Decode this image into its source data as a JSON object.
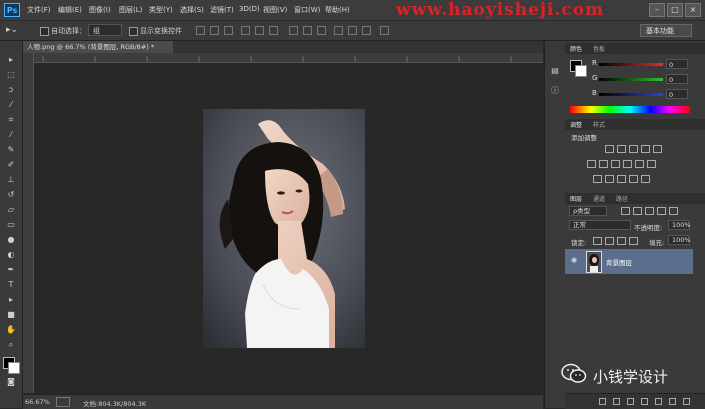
{
  "app": {
    "logo": "Ps",
    "watermark": "www.haoyisheji.com"
  },
  "menu": [
    "文件(F)",
    "编辑(E)",
    "图像(I)",
    "图层(L)",
    "类型(Y)",
    "选择(S)",
    "滤镜(T)",
    "3D(D)",
    "视图(V)",
    "窗口(W)",
    "帮助(H)"
  ],
  "window_controls": [
    "–",
    "□",
    "×"
  ],
  "options": {
    "auto_select_label": "自动选择：",
    "auto_select_value": "组",
    "show_transform_label": "显示变换控件",
    "workspace": "基本功能"
  },
  "document": {
    "tab_title": "人物.png @ 66.7% (背景图层, RGB/8#) *",
    "zoom": "66.67%",
    "doc_size": "文档:804.3K/804.3K"
  },
  "color_panel": {
    "tabs": [
      "颜色",
      "色板"
    ],
    "sliders": [
      {
        "label": "R",
        "value": "0",
        "color": "#d83030"
      },
      {
        "label": "G",
        "value": "0",
        "color": "#30c030"
      },
      {
        "label": "B",
        "value": "0",
        "color": "#3040e0"
      }
    ]
  },
  "adjust_panel": {
    "tabs": [
      "调整",
      "样式"
    ],
    "title": "添加调整"
  },
  "layers_panel": {
    "tabs": [
      "图层",
      "通道",
      "路径"
    ],
    "filter": "ρ类型",
    "blend_mode": "正常",
    "opacity_label": "不透明度:",
    "opacity_value": "100%",
    "lock_label": "锁定:",
    "fill_label": "填充:",
    "fill_value": "100%",
    "layer_name": "背景图层"
  },
  "wechat": {
    "text": "小钱学设计"
  },
  "colors": {
    "menubar": "#3c3c3c",
    "panel": "#3a3a3a",
    "canvas_bg": "#282828",
    "layer_selected": "#5b6f8c",
    "watermark": "#d8232a"
  },
  "icons": [
    "move-tool-icon",
    "marquee-tool-icon",
    "lasso-tool-icon",
    "quick-select-icon",
    "crop-tool-icon",
    "eyedropper-icon",
    "healing-brush-icon",
    "brush-tool-icon",
    "clone-stamp-icon",
    "history-brush-icon",
    "eraser-icon",
    "gradient-icon",
    "blur-icon",
    "dodge-icon",
    "pen-tool-icon",
    "type-tool-icon",
    "path-select-icon",
    "rectangle-tool-icon",
    "hand-tool-icon",
    "zoom-tool-icon"
  ]
}
